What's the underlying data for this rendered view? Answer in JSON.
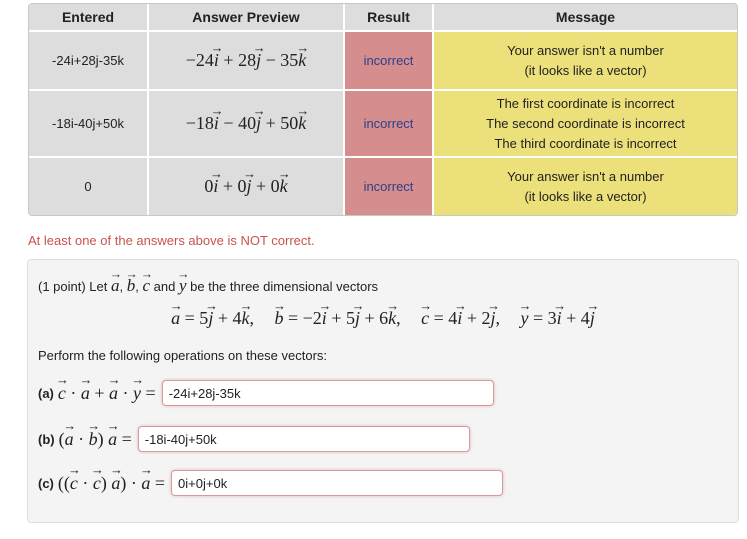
{
  "results_table": {
    "headers": [
      "Entered",
      "Answer Preview",
      "Result",
      "Message"
    ],
    "rows": [
      {
        "entered": "-24i+28j-35k",
        "preview": {
          "c1": "−24",
          "op1": "+",
          "c2": "28",
          "op2": "−",
          "c3": "35"
        },
        "result": "incorrect",
        "message": [
          "Your answer isn't a number",
          "(it looks like a vector)"
        ]
      },
      {
        "entered": "-18i-40j+50k",
        "preview": {
          "c1": "−18",
          "op1": "−",
          "c2": "40",
          "op2": "+",
          "c3": "50"
        },
        "result": "incorrect",
        "message": [
          "The first coordinate is incorrect",
          "The second coordinate is incorrect",
          "The third coordinate is incorrect"
        ]
      },
      {
        "entered": "0",
        "preview": {
          "c1": "0",
          "op1": "+",
          "c2": "0",
          "op2": "+",
          "c3": "0"
        },
        "result": "incorrect",
        "message": [
          "Your answer isn't a number",
          "(it looks like a vector)"
        ]
      }
    ],
    "colors": {
      "header_bg": "#dddddd",
      "incorrect_bg": "#d58d8d",
      "message_bg": "#ebe07a",
      "result_text": "#2b3f8c"
    }
  },
  "feedback": {
    "text": "At least one of the answers above is NOT correct.",
    "color": "#c9524e"
  },
  "problem": {
    "points": "(1 point) Let",
    "intro_and": "and",
    "intro_tail": "be the three dimensional vectors",
    "vectors": {
      "a": "= 5 j + 4 k",
      "b": "= −2 i + 5 j + 6 k",
      "c": "= 4 i + 2 j",
      "y": "= 3 i + 4 j"
    },
    "instruction": "Perform the following operations on these vectors:",
    "parts": [
      {
        "label": "(a)",
        "expression": "c · a + a · y =",
        "value": "-24i+28j-35k"
      },
      {
        "label": "(b)",
        "expression": "(a · b) a =",
        "value": "-18i-40j+50k"
      },
      {
        "label": "(c)",
        "expression": "((c · c) a) · a =",
        "value": "0i+0j+0k"
      }
    ]
  }
}
